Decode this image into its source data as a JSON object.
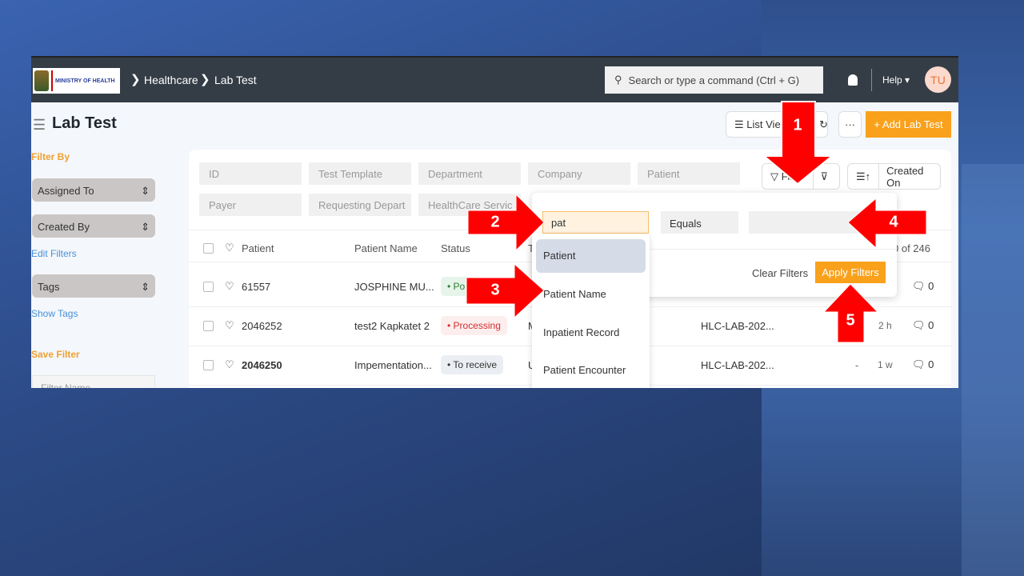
{
  "navbar": {
    "logo_text": "MINISTRY OF HEALTH",
    "breadcrumbs": [
      "Healthcare",
      "Lab Test"
    ],
    "search_placeholder": "Search or type a command (Ctrl + G)",
    "help": "Help",
    "avatar": "TU"
  },
  "page": {
    "title": "Lab Test",
    "list_view": "List Vie",
    "add_button": "+ Add Lab Test",
    "more": "···"
  },
  "sidebar": {
    "filter_by": "Filter By",
    "assigned_to": "Assigned To",
    "created_by": "Created By",
    "edit_filters": "Edit Filters",
    "tags": "Tags",
    "show_tags": "Show Tags",
    "save_filter": "Save Filter",
    "filter_name_placeholder": "Filter Name"
  },
  "filters": {
    "row1": [
      "ID",
      "Test Template",
      "Department",
      "Company",
      "Patient"
    ],
    "row2": [
      "Payer",
      "Requesting Depart",
      "HealthCare Servic"
    ],
    "filter_button": "Filter",
    "sort_label": "Created On"
  },
  "filter_popup": {
    "field_value": "pat",
    "condition": "Equals",
    "value": "",
    "clear": "Clear Filters",
    "apply": "Apply Filters",
    "options": [
      "Patient",
      "Patient Name",
      "Inpatient Record",
      "Patient Encounter"
    ]
  },
  "table": {
    "headers": [
      "Patient",
      "Patient Name",
      "Status",
      "T"
    ],
    "count": "0 of 246",
    "rows": [
      {
        "id": "61557",
        "name": "JOSPHINE MU...",
        "status": "Po",
        "col4": "",
        "ref": "",
        "dash": "",
        "time": "",
        "comments": "0"
      },
      {
        "id": "2046252",
        "name": "test2 Kapkatet 2",
        "status": "Processing",
        "col4": "M",
        "ref": "HLC-LAB-202...",
        "dash": "",
        "time": "2 h",
        "comments": "0"
      },
      {
        "id": "2046250",
        "name": "Impementation...",
        "status": "To receive",
        "col4": "U",
        "ref": "HLC-LAB-202...",
        "dash": "-",
        "time": "1 w",
        "comments": "0"
      }
    ]
  },
  "annotations": [
    "1",
    "2",
    "3",
    "4",
    "5"
  ],
  "colors": {
    "navbar": "#343d46",
    "accent": "#f9a11b",
    "arrow": "#ff0000",
    "link": "#4a90d9"
  }
}
